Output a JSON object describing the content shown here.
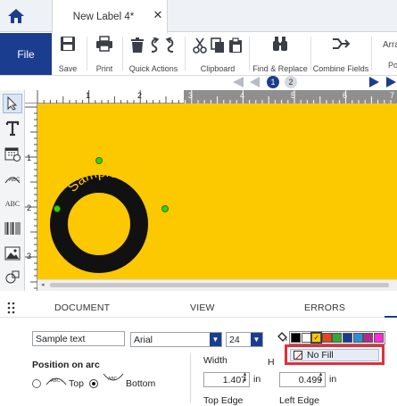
{
  "tab": {
    "title": "New Label 4*",
    "close": "✕"
  },
  "ribbon": {
    "file": "File",
    "save": "Save",
    "print": "Print",
    "quick_actions": "Quick Actions",
    "clipboard": "Clipboard",
    "find_replace": "Find & Replace",
    "combine_fields": "Combine Fields",
    "arrange_partial": "Arra",
    "position_partial": "Po"
  },
  "pages": {
    "current": "1",
    "next": "2"
  },
  "canvas": {
    "arc_text": "Sample text",
    "label_color": "#fcc800",
    "ruler_h": [
      "1",
      "2",
      "3",
      "4",
      "5",
      "6",
      "7"
    ],
    "ruler_v": [
      "1",
      "2",
      "3"
    ]
  },
  "panel": {
    "tabs": [
      "DOCUMENT",
      "VIEW",
      "ERRORS"
    ],
    "text_value": "Sample text",
    "font": "Arial",
    "font_size": "24",
    "position_on_arc": "Position on arc",
    "top": "Top",
    "bottom": "Bottom",
    "width_label": "Width",
    "width_value": "1.407",
    "width_unit": "in",
    "height_value": "0.499",
    "height_unit": "in",
    "top_edge": "Top Edge",
    "left_edge": "Left Edge",
    "no_fill": "No Fill",
    "palette": [
      "#000000",
      "#ffffff",
      "#fcc800",
      "#e8451e",
      "#3aa535",
      "#1a3d8f",
      "#2c8fd6",
      "#b02b8e",
      "#ff2bd6"
    ]
  }
}
